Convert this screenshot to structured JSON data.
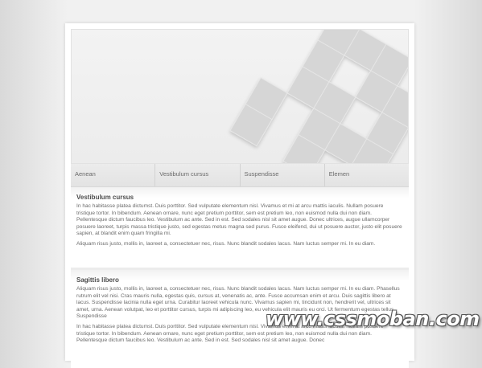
{
  "nav": {
    "items": [
      "Aenean",
      "Vestibulum cursus",
      "Suspendisse",
      "Elemen"
    ]
  },
  "sections": [
    {
      "title": "Vestibulum cursus",
      "paragraphs": [
        "In hac habitasse platea dictumst. Duis porttitor. Sed vulputate elementum nisl. Vivamus et mi at arcu mattis iaculis. Nullam posuere tristique tortor. In bibendum. Aenean ornare, nunc eget pretium porttitor, sem est pretium leo, non euismod nulla dui non diam. Pellentesque dictum faucibus leo. Vestibulum ac ante. Sed in est. Sed sodales nisl sit amet augue. Donec ultrices, augue ullamcorper posuere laoreet, turpis massa tristique justo, sed egestas metus magna sed purus. Fusce eleifend, dui ut posuere auctor, justo elit posuere sapien, at blandit enim quam fringilla mi.",
        "Aliquam risus justo, mollis in, laoreet a, consectetuer nec, risus. Nunc blandit sodales lacus. Nam luctus semper mi. In eu diam."
      ]
    },
    {
      "title": "Sagittis libero",
      "paragraphs": [
        "Aliquam risus justo, mollis in, laoreet a, consectetuer nec, risus. Nunc blandit sodales lacus. Nam luctus semper mi. In eu diam. Phasellus rutrum elit vel nisi. Cras mauris nulla, egestas quis, cursus at, venenatis ac, ante. Fusce accumsan enim et arcu. Duis sagittis libero at lacus. Suspendisse lacinia nulla eget urna. Curabitur laoreet vehicula nunc. Vivamus sapien mi, tincidunt non, hendrerit vel, ultrices sit amet, urna. Aenean volutpat, leo et porttitor cursus, turpis mi adipiscing leo, eu vehicula elit mauris eu orci. Ut fermentum egestas tellus. Suspendisse",
        "In hac habitasse platea dictumst. Duis porttitor. Sed vulputate elementum nisl. Vivamus et mi at arcu mattis iaculis. Nullam posuere tristique tortor. In bibendum. Aenean ornare, nunc eget pretium porttitor, sem est pretium leo, non euismod nulla dui non diam. Pellentesque dictum faucibus leo. Vestibulum ac ante. Sed in est. Sed sodales nisl sit amet augue. Donec"
      ]
    }
  ],
  "watermark": "www.cssmoban.com"
}
